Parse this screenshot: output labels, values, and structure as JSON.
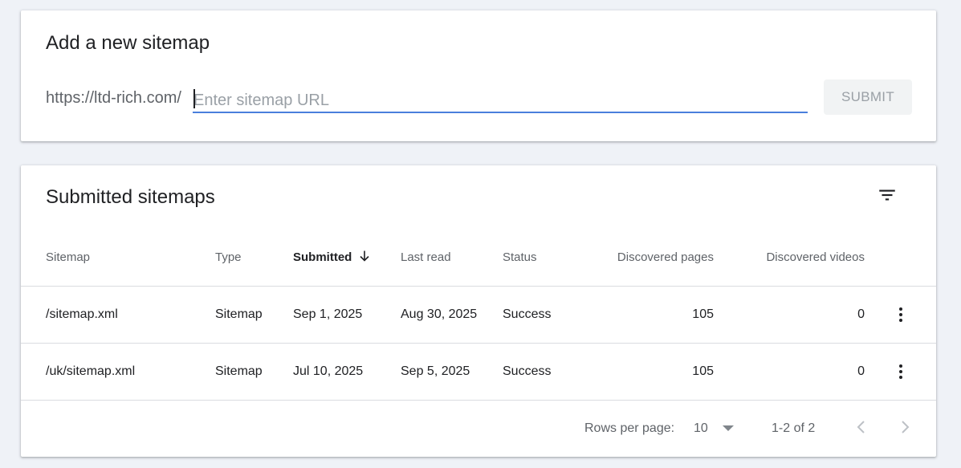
{
  "add_sitemap": {
    "title": "Add a new sitemap",
    "prefix": "https://ltd-rich.com/",
    "input_placeholder": "Enter sitemap URL",
    "input_value": "",
    "submit_label": "SUBMIT"
  },
  "submitted": {
    "title": "Submitted sitemaps",
    "columns": {
      "sitemap": "Sitemap",
      "type": "Type",
      "submitted": "Submitted",
      "last_read": "Last read",
      "status": "Status",
      "discovered_pages": "Discovered pages",
      "discovered_videos": "Discovered videos"
    },
    "sort_column": "submitted",
    "sort_direction": "descending",
    "rows": [
      {
        "sitemap": "/sitemap.xml",
        "type": "Sitemap",
        "submitted": "Sep 1, 2025",
        "last_read": "Aug 30, 2025",
        "status": "Success",
        "discovered_pages": "105",
        "discovered_videos": "0"
      },
      {
        "sitemap": "/uk/sitemap.xml",
        "type": "Sitemap",
        "submitted": "Jul 10, 2025",
        "last_read": "Sep 5, 2025",
        "status": "Success",
        "discovered_pages": "105",
        "discovered_videos": "0"
      }
    ],
    "footer": {
      "rows_per_page_label": "Rows per page:",
      "rows_per_page_value": "10",
      "range": "1-2 of 2"
    }
  },
  "colors": {
    "page_background": "#eff2f7",
    "input_underline": "#4a7fdc",
    "success": "#188038"
  },
  "icons": [
    "filter-icon",
    "arrow-down-icon",
    "more-vert-icon",
    "chevron-down-icon",
    "chevron-left-icon",
    "chevron-right-icon"
  ]
}
